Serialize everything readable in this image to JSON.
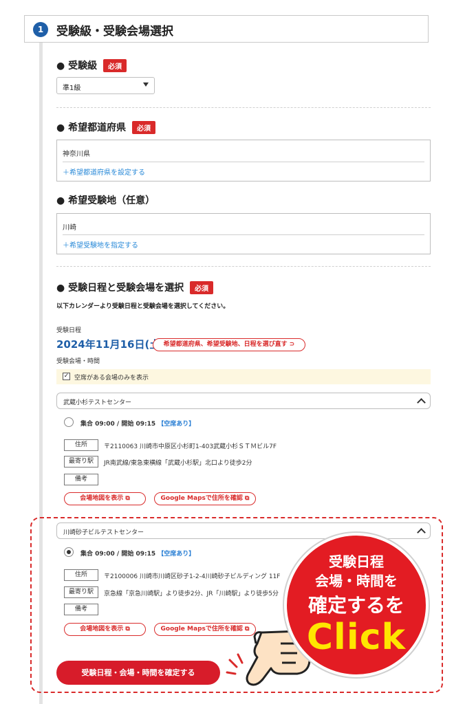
{
  "step": {
    "number": "1",
    "title": "受験級・受験会場選択"
  },
  "grade": {
    "label": "受験級",
    "required": "必須",
    "selected": "準1級"
  },
  "prefecture": {
    "label": "希望都道府県",
    "required": "必須",
    "value": "神奈川県",
    "link": "＋希望都道府県を設定する"
  },
  "area": {
    "label": "希望受験地（任意）",
    "value": "川崎",
    "link": "＋希望受験地を指定する"
  },
  "schedule": {
    "label": "受験日程と受験会場を選択",
    "required": "必須",
    "instruction": "以下カレンダーより受験日程と受験会場を選択してください。",
    "date_label": "受験日程",
    "date": "2024年11月16日(土)",
    "reselect": "希望都道府県、希望受験地、日程を選び直す ⊃",
    "venue_time_label": "受験会場・時間",
    "filter": "空席がある会場のみを表示"
  },
  "venues": [
    {
      "name": "武蔵小杉テストセンター",
      "time": "集合 09:00 / 開始 09:15",
      "availability": "【空席あり】",
      "address_tag": "住所",
      "address": "〒2110063 川崎市中原区小杉町1-403武蔵小杉ＳＴＭビル7F",
      "station_tag": "最寄り駅",
      "station": "JR南武線/東急東横線「武蔵小杉駅」北口より徒歩2分",
      "notes_tag": "備考",
      "map_button": "会場地図を表示",
      "gmaps_button": "Google Mapsで住所を確認"
    },
    {
      "name": "川崎砂子ビルテストセンター",
      "time": "集合 09:00 / 開始 09:15",
      "availability": "【空席あり】",
      "address_tag": "住所",
      "address": "〒2100006 川崎市川崎区砂子1-2-4川崎砂子ビルディング 11F",
      "station_tag": "最寄り駅",
      "station": "京急線「京急川崎駅」より徒歩2分、JR「川崎駅」より徒歩5分",
      "notes_tag": "備考",
      "map_button": "会場地図を表示",
      "gmaps_button": "Google Mapsで住所を確認"
    }
  ],
  "confirm_button": "受験日程・会場・時間を確定する",
  "callout": {
    "line1": "受験日程",
    "line2": "会場・時間を",
    "line3": "確定するを",
    "line4": "Click"
  },
  "colors": {
    "accent_red": "#d71c2a",
    "step_blue": "#1f5fa8",
    "link_blue": "#2a8ad8",
    "badge_red": "#e31c23",
    "click_yellow": "#ffe600"
  }
}
